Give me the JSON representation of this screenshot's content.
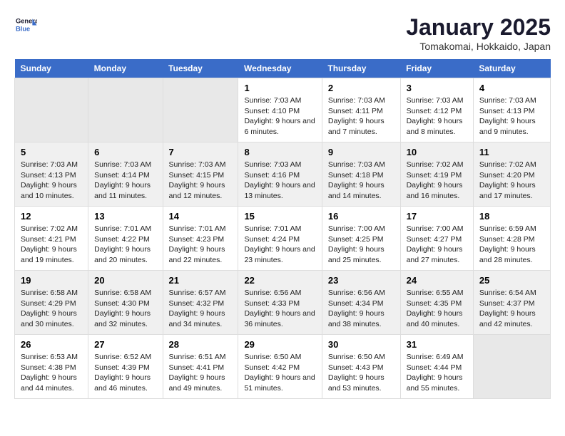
{
  "header": {
    "logo_line1": "General",
    "logo_line2": "Blue",
    "month": "January 2025",
    "location": "Tomakomai, Hokkaido, Japan"
  },
  "weekdays": [
    "Sunday",
    "Monday",
    "Tuesday",
    "Wednesday",
    "Thursday",
    "Friday",
    "Saturday"
  ],
  "weeks": [
    [
      {
        "day": "",
        "text": ""
      },
      {
        "day": "",
        "text": ""
      },
      {
        "day": "",
        "text": ""
      },
      {
        "day": "1",
        "text": "Sunrise: 7:03 AM\nSunset: 4:10 PM\nDaylight: 9 hours and 6 minutes."
      },
      {
        "day": "2",
        "text": "Sunrise: 7:03 AM\nSunset: 4:11 PM\nDaylight: 9 hours and 7 minutes."
      },
      {
        "day": "3",
        "text": "Sunrise: 7:03 AM\nSunset: 4:12 PM\nDaylight: 9 hours and 8 minutes."
      },
      {
        "day": "4",
        "text": "Sunrise: 7:03 AM\nSunset: 4:13 PM\nDaylight: 9 hours and 9 minutes."
      }
    ],
    [
      {
        "day": "5",
        "text": "Sunrise: 7:03 AM\nSunset: 4:13 PM\nDaylight: 9 hours and 10 minutes."
      },
      {
        "day": "6",
        "text": "Sunrise: 7:03 AM\nSunset: 4:14 PM\nDaylight: 9 hours and 11 minutes."
      },
      {
        "day": "7",
        "text": "Sunrise: 7:03 AM\nSunset: 4:15 PM\nDaylight: 9 hours and 12 minutes."
      },
      {
        "day": "8",
        "text": "Sunrise: 7:03 AM\nSunset: 4:16 PM\nDaylight: 9 hours and 13 minutes."
      },
      {
        "day": "9",
        "text": "Sunrise: 7:03 AM\nSunset: 4:18 PM\nDaylight: 9 hours and 14 minutes."
      },
      {
        "day": "10",
        "text": "Sunrise: 7:02 AM\nSunset: 4:19 PM\nDaylight: 9 hours and 16 minutes."
      },
      {
        "day": "11",
        "text": "Sunrise: 7:02 AM\nSunset: 4:20 PM\nDaylight: 9 hours and 17 minutes."
      }
    ],
    [
      {
        "day": "12",
        "text": "Sunrise: 7:02 AM\nSunset: 4:21 PM\nDaylight: 9 hours and 19 minutes."
      },
      {
        "day": "13",
        "text": "Sunrise: 7:01 AM\nSunset: 4:22 PM\nDaylight: 9 hours and 20 minutes."
      },
      {
        "day": "14",
        "text": "Sunrise: 7:01 AM\nSunset: 4:23 PM\nDaylight: 9 hours and 22 minutes."
      },
      {
        "day": "15",
        "text": "Sunrise: 7:01 AM\nSunset: 4:24 PM\nDaylight: 9 hours and 23 minutes."
      },
      {
        "day": "16",
        "text": "Sunrise: 7:00 AM\nSunset: 4:25 PM\nDaylight: 9 hours and 25 minutes."
      },
      {
        "day": "17",
        "text": "Sunrise: 7:00 AM\nSunset: 4:27 PM\nDaylight: 9 hours and 27 minutes."
      },
      {
        "day": "18",
        "text": "Sunrise: 6:59 AM\nSunset: 4:28 PM\nDaylight: 9 hours and 28 minutes."
      }
    ],
    [
      {
        "day": "19",
        "text": "Sunrise: 6:58 AM\nSunset: 4:29 PM\nDaylight: 9 hours and 30 minutes."
      },
      {
        "day": "20",
        "text": "Sunrise: 6:58 AM\nSunset: 4:30 PM\nDaylight: 9 hours and 32 minutes."
      },
      {
        "day": "21",
        "text": "Sunrise: 6:57 AM\nSunset: 4:32 PM\nDaylight: 9 hours and 34 minutes."
      },
      {
        "day": "22",
        "text": "Sunrise: 6:56 AM\nSunset: 4:33 PM\nDaylight: 9 hours and 36 minutes."
      },
      {
        "day": "23",
        "text": "Sunrise: 6:56 AM\nSunset: 4:34 PM\nDaylight: 9 hours and 38 minutes."
      },
      {
        "day": "24",
        "text": "Sunrise: 6:55 AM\nSunset: 4:35 PM\nDaylight: 9 hours and 40 minutes."
      },
      {
        "day": "25",
        "text": "Sunrise: 6:54 AM\nSunset: 4:37 PM\nDaylight: 9 hours and 42 minutes."
      }
    ],
    [
      {
        "day": "26",
        "text": "Sunrise: 6:53 AM\nSunset: 4:38 PM\nDaylight: 9 hours and 44 minutes."
      },
      {
        "day": "27",
        "text": "Sunrise: 6:52 AM\nSunset: 4:39 PM\nDaylight: 9 hours and 46 minutes."
      },
      {
        "day": "28",
        "text": "Sunrise: 6:51 AM\nSunset: 4:41 PM\nDaylight: 9 hours and 49 minutes."
      },
      {
        "day": "29",
        "text": "Sunrise: 6:50 AM\nSunset: 4:42 PM\nDaylight: 9 hours and 51 minutes."
      },
      {
        "day": "30",
        "text": "Sunrise: 6:50 AM\nSunset: 4:43 PM\nDaylight: 9 hours and 53 minutes."
      },
      {
        "day": "31",
        "text": "Sunrise: 6:49 AM\nSunset: 4:44 PM\nDaylight: 9 hours and 55 minutes."
      },
      {
        "day": "",
        "text": ""
      }
    ]
  ]
}
